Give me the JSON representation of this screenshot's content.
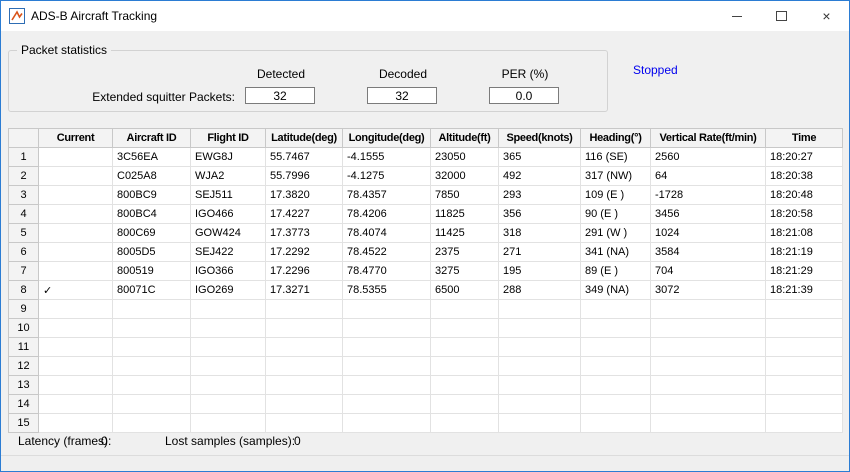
{
  "window": {
    "title": "ADS-B Aircraft Tracking",
    "close_glyph": "×"
  },
  "packet_stats": {
    "group_title": "Packet statistics",
    "row_label": "Extended squitter Packets:",
    "columns": [
      {
        "label": "Detected",
        "value": "32"
      },
      {
        "label": "Decoded",
        "value": "32"
      },
      {
        "label": "PER (%)",
        "value": "0.0"
      }
    ],
    "status_text": "Stopped",
    "status_color": "#0000EE"
  },
  "table": {
    "headers": [
      "Current",
      "Aircraft ID",
      "Flight ID",
      "Latitude(deg)",
      "Longitude(deg)",
      "Altitude(ft)",
      "Speed(knots)",
      "Heading(°)",
      "Vertical Rate(ft/min)",
      "Time"
    ],
    "rows": [
      {
        "num": "1",
        "cells": [
          "",
          "3C56EA",
          "EWG8J",
          "55.7467",
          "-4.1555",
          "23050",
          "365",
          "116 (SE)",
          "2560",
          "18:20:27"
        ]
      },
      {
        "num": "2",
        "cells": [
          "",
          "C025A8",
          "WJA2",
          "55.7996",
          "-4.1275",
          "32000",
          "492",
          "317 (NW)",
          "64",
          "18:20:38"
        ]
      },
      {
        "num": "3",
        "cells": [
          "",
          "800BC9",
          "SEJ511",
          "17.3820",
          "78.4357",
          "7850",
          "293",
          "109 (E )",
          "-1728",
          "18:20:48"
        ]
      },
      {
        "num": "4",
        "cells": [
          "",
          "800BC4",
          "IGO466",
          "17.4227",
          "78.4206",
          "11825",
          "356",
          "90 (E )",
          "3456",
          "18:20:58"
        ]
      },
      {
        "num": "5",
        "cells": [
          "",
          "800C69",
          "GOW424",
          "17.3773",
          "78.4074",
          "11425",
          "318",
          "291 (W )",
          "1024",
          "18:21:08"
        ]
      },
      {
        "num": "6",
        "cells": [
          "",
          "8005D5",
          "SEJ422",
          "17.2292",
          "78.4522",
          "2375",
          "271",
          "341 (NA)",
          "3584",
          "18:21:19"
        ]
      },
      {
        "num": "7",
        "cells": [
          "",
          "800519",
          "IGO366",
          "17.2296",
          "78.4770",
          "3275",
          "195",
          "89 (E )",
          "704",
          "18:21:29"
        ]
      },
      {
        "num": "8",
        "cells": [
          "✓",
          "80071C",
          "IGO269",
          "17.3271",
          "78.5355",
          "6500",
          "288",
          "349 (NA)",
          "3072",
          "18:21:39"
        ]
      },
      {
        "num": "9",
        "cells": [
          "",
          "",
          "",
          "",
          "",
          "",
          "",
          "",
          "",
          ""
        ]
      },
      {
        "num": "10",
        "cells": [
          "",
          "",
          "",
          "",
          "",
          "",
          "",
          "",
          "",
          ""
        ]
      },
      {
        "num": "11",
        "cells": [
          "",
          "",
          "",
          "",
          "",
          "",
          "",
          "",
          "",
          ""
        ]
      },
      {
        "num": "12",
        "cells": [
          "",
          "",
          "",
          "",
          "",
          "",
          "",
          "",
          "",
          ""
        ]
      },
      {
        "num": "13",
        "cells": [
          "",
          "",
          "",
          "",
          "",
          "",
          "",
          "",
          "",
          ""
        ]
      },
      {
        "num": "14",
        "cells": [
          "",
          "",
          "",
          "",
          "",
          "",
          "",
          "",
          "",
          ""
        ]
      },
      {
        "num": "15",
        "cells": [
          "",
          "",
          "",
          "",
          "",
          "",
          "",
          "",
          "",
          ""
        ]
      }
    ]
  },
  "footer": {
    "latency_label": "Latency (frames):",
    "latency_value": "0",
    "lost_label": "Lost samples (samples):",
    "lost_value": "0"
  }
}
